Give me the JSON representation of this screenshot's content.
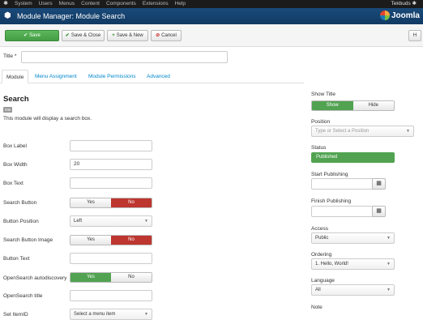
{
  "topbar": {
    "menu": [
      "System",
      "Users",
      "Menus",
      "Content",
      "Components",
      "Extensions",
      "Help"
    ],
    "user": "Tekbuds"
  },
  "header": {
    "title": "Module Manager: Module Search",
    "brand": "Joomla"
  },
  "toolbar": {
    "save": "Save",
    "save_close": "Save & Close",
    "save_new": "Save & New",
    "cancel": "Cancel",
    "help": "H"
  },
  "title_field": {
    "label": "Title *",
    "value": ""
  },
  "tabs": [
    "Module",
    "Menu Assignment",
    "Module Permissions",
    "Advanced"
  ],
  "module": {
    "heading": "Search",
    "badge": "Site",
    "description": "This module will display a search box."
  },
  "fields": {
    "box_label": {
      "label": "Box Label",
      "value": ""
    },
    "box_width": {
      "label": "Box Width",
      "value": "20"
    },
    "box_text": {
      "label": "Box Text",
      "value": ""
    },
    "search_button": {
      "label": "Search Button",
      "yes": "Yes",
      "no": "No",
      "selected": "No"
    },
    "button_position": {
      "label": "Button Position",
      "value": "Left"
    },
    "search_button_image": {
      "label": "Search Button Image",
      "yes": "Yes",
      "no": "No",
      "selected": "No"
    },
    "button_text": {
      "label": "Button Text",
      "value": ""
    },
    "opensearch_autodiscovery": {
      "label": "OpenSearch autodiscovery",
      "yes": "Yes",
      "no": "No",
      "selected": "Yes"
    },
    "opensearch_title": {
      "label": "OpenSearch title",
      "value": ""
    },
    "set_itemid": {
      "label": "Set ItemID",
      "value": "Select a menu item"
    }
  },
  "sidebar": {
    "show_title": {
      "label": "Show Title",
      "show": "Show",
      "hide": "Hide",
      "selected": "Show"
    },
    "position": {
      "label": "Position",
      "placeholder": "Type or Select a Position"
    },
    "status": {
      "label": "Status",
      "value": "Published"
    },
    "start_publishing": {
      "label": "Start Publishing",
      "value": ""
    },
    "finish_publishing": {
      "label": "Finish Publishing",
      "value": ""
    },
    "access": {
      "label": "Access",
      "value": "Public"
    },
    "ordering": {
      "label": "Ordering",
      "value": "1. Hello, World!"
    },
    "language": {
      "label": "Language",
      "value": "All"
    },
    "note": {
      "label": "Note"
    }
  },
  "colors": {
    "header_bg": "#113a63",
    "save_green": "#449d44",
    "toggle_red": "#bd362f",
    "toggle_green": "#51a351",
    "link_blue": "#0088cc"
  }
}
